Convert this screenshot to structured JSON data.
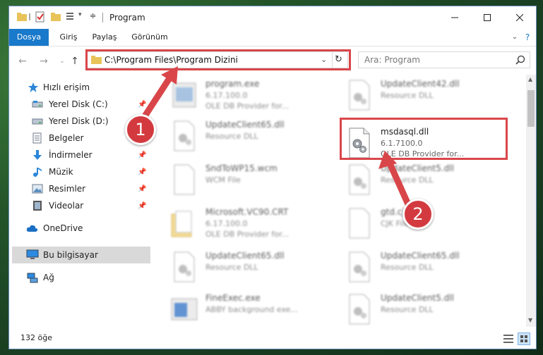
{
  "window": {
    "title": "Program"
  },
  "ribbon": {
    "tabs": [
      "Dosya",
      "Giriş",
      "Paylaş",
      "Görünüm"
    ]
  },
  "address": {
    "path": "C:\\Program Files\\Program Dizini"
  },
  "search": {
    "placeholder": "Ara: Program"
  },
  "nav_pane": {
    "items": [
      {
        "label": "Hızlı erişim"
      },
      {
        "label": "Yerel Disk (C:)"
      },
      {
        "label": "Yerel Disk (D:)"
      },
      {
        "label": "Belgeler"
      },
      {
        "label": "İndirmeler"
      },
      {
        "label": "Müzik"
      },
      {
        "label": "Resimler"
      },
      {
        "label": "Videolar"
      },
      {
        "label": "OneDrive"
      },
      {
        "label": "Bu bilgisayar"
      },
      {
        "label": "Ağ"
      }
    ]
  },
  "files": [
    {
      "name": "program.exe",
      "line2": "6.17.100.0",
      "line3": "OLE DB Provider for..."
    },
    {
      "name": "UpdateClient42.dll",
      "line2": "Resource DLL",
      "line3": ""
    },
    {
      "name": "UpdateClient65.dll",
      "line2": "Resource DLL",
      "line3": ""
    },
    {
      "name": "msdasql.dll",
      "line2": "6.1.7100.0",
      "line3": "OLE DB Provider for..."
    },
    {
      "name": "SndToWP15.wcm",
      "line2": "WCM File",
      "line3": ""
    },
    {
      "name": "UpdateClient5.dll",
      "line2": "Resource DLL",
      "line3": ""
    },
    {
      "name": "Microsoft.VC90.CRT",
      "line2": "6.17.100.0",
      "line3": "OLE DB Provider for..."
    },
    {
      "name": "gtd.cjk",
      "line2": "CJK File",
      "line3": ""
    },
    {
      "name": "UpdateClient65.dll",
      "line2": "Resource DLL",
      "line3": ""
    },
    {
      "name": "UpdateClient65.dll",
      "line2": "Resource DLL",
      "line3": ""
    },
    {
      "name": "FineExec.exe",
      "line2": "ABBY background exe...",
      "line3": ""
    },
    {
      "name": "UpdateClient5.dll",
      "line2": "Resource DLL",
      "line3": ""
    }
  ],
  "status": {
    "count": "132 öğe"
  },
  "annotations": {
    "step1": "1",
    "step2": "2",
    "color": "#d9464a"
  },
  "colors": {
    "accent": "#1979ca",
    "selected": "#d9d9d9"
  }
}
